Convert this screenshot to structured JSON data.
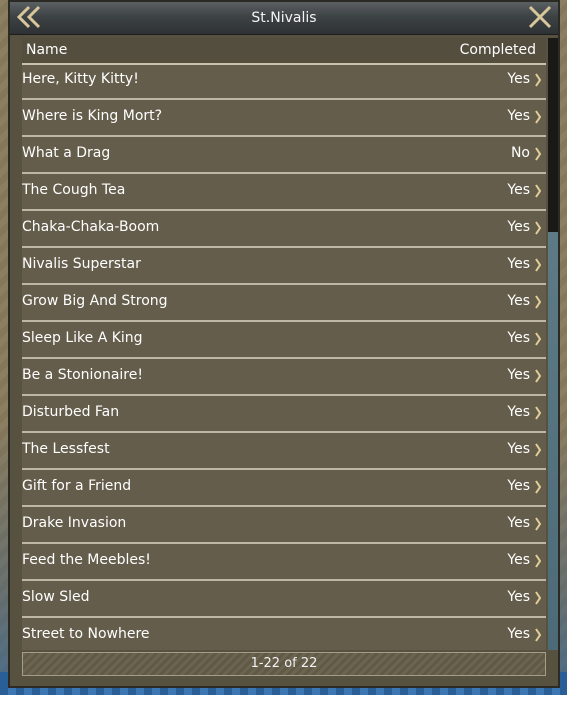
{
  "window": {
    "title": "St.Nivalis"
  },
  "table": {
    "header_name": "Name",
    "header_completed": "Completed",
    "rows": [
      {
        "name": "Here, Kitty Kitty!",
        "completed": "Yes"
      },
      {
        "name": "Where is King Mort?",
        "completed": "Yes"
      },
      {
        "name": "What a Drag",
        "completed": "No"
      },
      {
        "name": "The Cough Tea",
        "completed": "Yes"
      },
      {
        "name": "Chaka-Chaka-Boom",
        "completed": "Yes"
      },
      {
        "name": "Nivalis Superstar",
        "completed": "Yes"
      },
      {
        "name": "Grow Big And Strong",
        "completed": "Yes"
      },
      {
        "name": "Sleep Like A King",
        "completed": "Yes"
      },
      {
        "name": "Be a Stonionaire!",
        "completed": "Yes"
      },
      {
        "name": "Disturbed Fan",
        "completed": "Yes"
      },
      {
        "name": "The Lessfest",
        "completed": "Yes"
      },
      {
        "name": "Gift for a Friend",
        "completed": "Yes"
      },
      {
        "name": "Drake Invasion",
        "completed": "Yes"
      },
      {
        "name": "Feed the Meebles!",
        "completed": "Yes"
      },
      {
        "name": "Slow Sled",
        "completed": "Yes"
      },
      {
        "name": "Street to Nowhere",
        "completed": "Yes"
      }
    ]
  },
  "footer": {
    "pagination": "1-22 of 22"
  },
  "icons": {
    "back": "double-chevron-left-icon",
    "close": "close-x-icon",
    "row_arrow": "chevron-right-icon"
  },
  "colors": {
    "title_bar": "#3d4245",
    "panel": "#57513f",
    "text": "#ffffff",
    "row_divider": "#bdb8a5"
  }
}
